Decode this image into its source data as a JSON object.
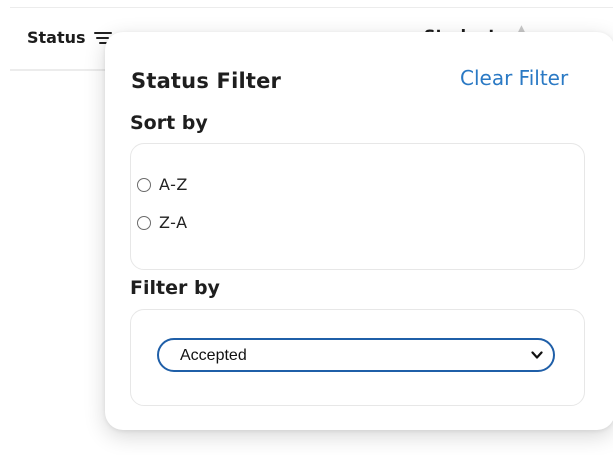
{
  "table_header": {
    "status_label": "Status",
    "student_label": "Student"
  },
  "popover": {
    "title": "Status Filter",
    "clear_label": "Clear Filter",
    "sort": {
      "label": "Sort by",
      "options": [
        "A-Z",
        "Z-A"
      ]
    },
    "filter": {
      "label": "Filter by",
      "selected": "Accepted"
    }
  },
  "colors": {
    "accent_link": "#2a79c4",
    "select_border": "#1f5fa8"
  }
}
